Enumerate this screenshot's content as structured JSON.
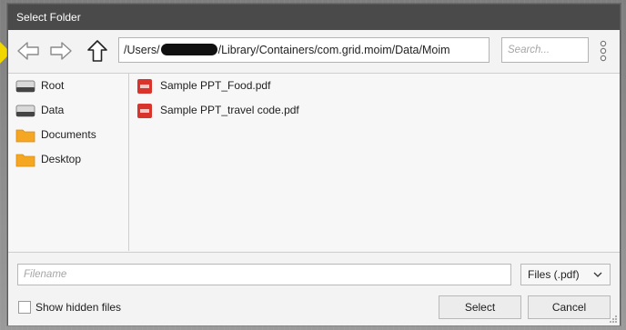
{
  "dialog": {
    "title": "Select Folder"
  },
  "toolbar": {
    "path_prefix": "/Users/",
    "path_suffix": "/Library/Containers/com.grid.moim/Data/Moim",
    "search_placeholder": "Search..."
  },
  "sidebar": {
    "items": [
      {
        "label": "Root",
        "icon": "drive-icon"
      },
      {
        "label": "Data",
        "icon": "drive-icon"
      },
      {
        "label": "Documents",
        "icon": "folder-icon"
      },
      {
        "label": "Desktop",
        "icon": "folder-icon"
      }
    ]
  },
  "files": [
    {
      "name": "Sample PPT_Food.pdf",
      "icon": "pdf-icon"
    },
    {
      "name": "Sample PPT_travel code.pdf",
      "icon": "pdf-icon"
    }
  ],
  "bottom": {
    "filename_placeholder": "Filename",
    "filter_label": "Files (.pdf)",
    "show_hidden_label": "Show hidden files",
    "select_label": "Select",
    "cancel_label": "Cancel"
  },
  "colors": {
    "titlebar": "#4a4a4a",
    "pdf_badge": "#d9342b",
    "folder": "#f5a623",
    "highlight_pointer": "#f2d600"
  }
}
